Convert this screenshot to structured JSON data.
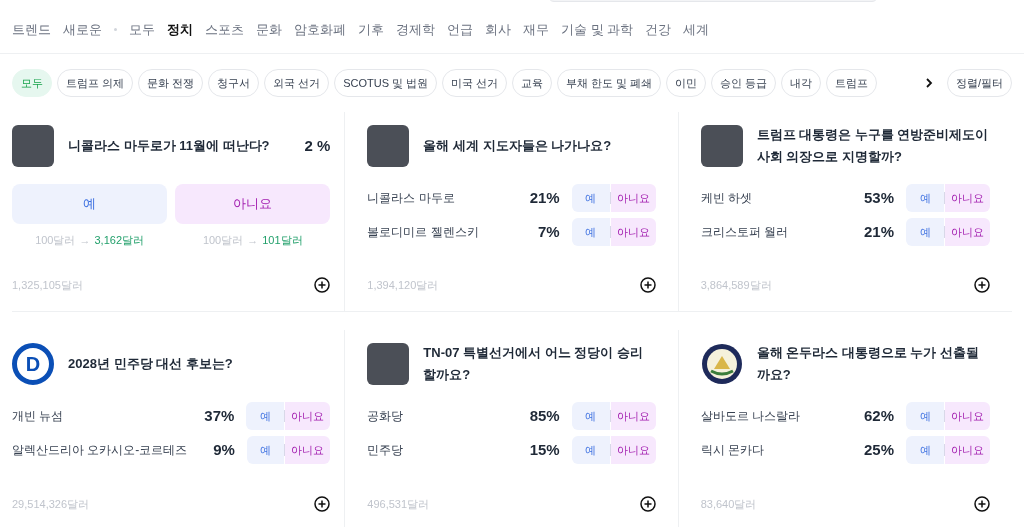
{
  "nav": [
    {
      "label": "트렌드",
      "selected": false
    },
    {
      "label": "새로운",
      "selected": false
    },
    {
      "label": "모두",
      "selected": false
    },
    {
      "label": "정치",
      "selected": true
    },
    {
      "label": "스포츠",
      "selected": false
    },
    {
      "label": "문화",
      "selected": false
    },
    {
      "label": "암호화폐",
      "selected": false
    },
    {
      "label": "기후",
      "selected": false
    },
    {
      "label": "경제학",
      "selected": false
    },
    {
      "label": "언급",
      "selected": false
    },
    {
      "label": "회사",
      "selected": false
    },
    {
      "label": "재무",
      "selected": false
    },
    {
      "label": "기술 및 과학",
      "selected": false
    },
    {
      "label": "건강",
      "selected": false
    },
    {
      "label": "세계",
      "selected": false
    }
  ],
  "chips": [
    {
      "label": "모두",
      "selected": true
    },
    {
      "label": "트럼프 의제",
      "selected": false
    },
    {
      "label": "문화 전쟁",
      "selected": false
    },
    {
      "label": "청구서",
      "selected": false
    },
    {
      "label": "외국 선거",
      "selected": false
    },
    {
      "label": "SCOTUS 및 법원",
      "selected": false
    },
    {
      "label": "미국 선거",
      "selected": false
    },
    {
      "label": "교육",
      "selected": false
    },
    {
      "label": "부채 한도 및 폐쇄",
      "selected": false
    },
    {
      "label": "이민",
      "selected": false
    },
    {
      "label": "승인 등급",
      "selected": false
    },
    {
      "label": "내각",
      "selected": false
    },
    {
      "label": "트럼프",
      "selected": false
    }
  ],
  "sort_button": "정렬/필터",
  "markets": [
    {
      "kind": "binary",
      "image": {
        "kind": "photo"
      },
      "title": "니콜라스 마두로가 11월에 떠난다?",
      "percent": "2 %",
      "yes": "예",
      "no": "아니요",
      "yes_payout": {
        "stake": "100달러",
        "arrow": "→",
        "win": "3,162달러"
      },
      "no_payout": {
        "stake": "100달러",
        "arrow": "→",
        "win": "101달러"
      },
      "volume": "1,325,105달러"
    },
    {
      "kind": "multi",
      "image": {
        "kind": "photo"
      },
      "title": "올해 세계 지도자들은 나가나요?",
      "outcomes": [
        {
          "name": "니콜라스 마두로",
          "percent": "21%",
          "yes": "예",
          "no": "아니요"
        },
        {
          "name": "볼로디미르 젤렌스키",
          "percent": "7%",
          "yes": "예",
          "no": "아니요"
        }
      ],
      "volume": "1,394,120달러"
    },
    {
      "kind": "multi",
      "image": {
        "kind": "photo"
      },
      "title": "트럼프 대통령은 누구를 연방준비제도이사회 의장으로 지명할까?",
      "outcomes": [
        {
          "name": "케빈 하셋",
          "percent": "53%",
          "yes": "예",
          "no": "아니요"
        },
        {
          "name": "크리스토퍼 월러",
          "percent": "21%",
          "yes": "예",
          "no": "아니요"
        }
      ],
      "volume": "3,864,589달러"
    },
    {
      "kind": "multi",
      "image": {
        "kind": "logo",
        "text": "D"
      },
      "title": "2028년 민주당 대선 후보는?",
      "outcomes": [
        {
          "name": "개빈 뉴섬",
          "percent": "37%",
          "yes": "예",
          "no": "아니요"
        },
        {
          "name": "알렉산드리아 오카시오-코르테즈",
          "percent": "9%",
          "yes": "예",
          "no": "아니요"
        }
      ],
      "volume": "29,514,326달러"
    },
    {
      "kind": "multi",
      "image": {
        "kind": "photo"
      },
      "title": "TN-07 특별선거에서 어느 정당이 승리할까요?",
      "outcomes": [
        {
          "name": "공화당",
          "percent": "85%",
          "yes": "예",
          "no": "아니요"
        },
        {
          "name": "민주당",
          "percent": "15%",
          "yes": "예",
          "no": "아니요"
        }
      ],
      "volume": "496,531달러"
    },
    {
      "kind": "multi",
      "image": {
        "kind": "seal"
      },
      "title": "올해 온두라스 대통령으로 누가 선출될까요?",
      "outcomes": [
        {
          "name": "살바도르 나스랄라",
          "percent": "62%",
          "yes": "예",
          "no": "아니요"
        },
        {
          "name": "릭시 몬카다",
          "percent": "25%",
          "yes": "예",
          "no": "아니요"
        }
      ],
      "volume": "83,640달러"
    }
  ]
}
